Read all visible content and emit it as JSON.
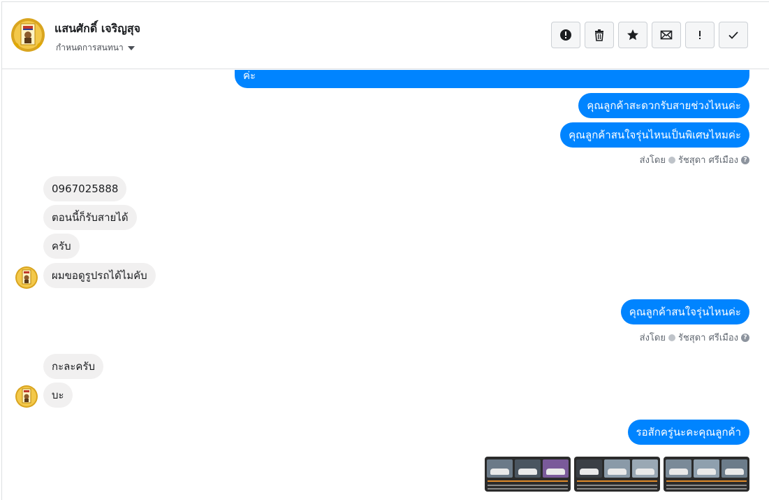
{
  "header": {
    "contact_name": "แสนศักดิ์ เจริญสุจ",
    "assign_label": "กำหนดการสนทนา",
    "actions": [
      {
        "icon": "alert-icon",
        "label": "spam"
      },
      {
        "icon": "trash-icon",
        "label": "delete"
      },
      {
        "icon": "star-icon",
        "label": "star"
      },
      {
        "icon": "mail-icon",
        "label": "mark unread"
      },
      {
        "icon": "exclamation-icon",
        "label": "follow up"
      },
      {
        "icon": "check-icon",
        "label": "done"
      }
    ]
  },
  "messages": {
    "out_1": "ค่ะ",
    "out_2": "คุณลูกค้าสะดวกรับสายช่วงไหนค่ะ",
    "out_3": "คุณลูกค้าสนใจรุ่นไหนเป็นพิเศษไหมค่ะ",
    "sent_by_1": "ส่งโดย",
    "sender_1": "รัชสุดา ศรีเมือง",
    "in_1": "0967025888",
    "in_2": "ตอนนี้ก็รับสายได้",
    "in_3": "ครับ",
    "in_4": "ผมขอดูรูปรถได้ไมคับ",
    "out_4": "คุณลูกค้าสนใจรุ่นไหนค่ะ",
    "sent_by_2": "ส่งโดย",
    "sender_2": "รัชสุดา ศรีเมือง",
    "in_5": "กะละครับ",
    "in_6": "บะ",
    "out_5": "รอสักครู่นะคะคุณลูกค้า"
  },
  "colors": {
    "outgoing": "#0084ff",
    "incoming": "#f1f0f0",
    "icon": "#1c1e21"
  }
}
